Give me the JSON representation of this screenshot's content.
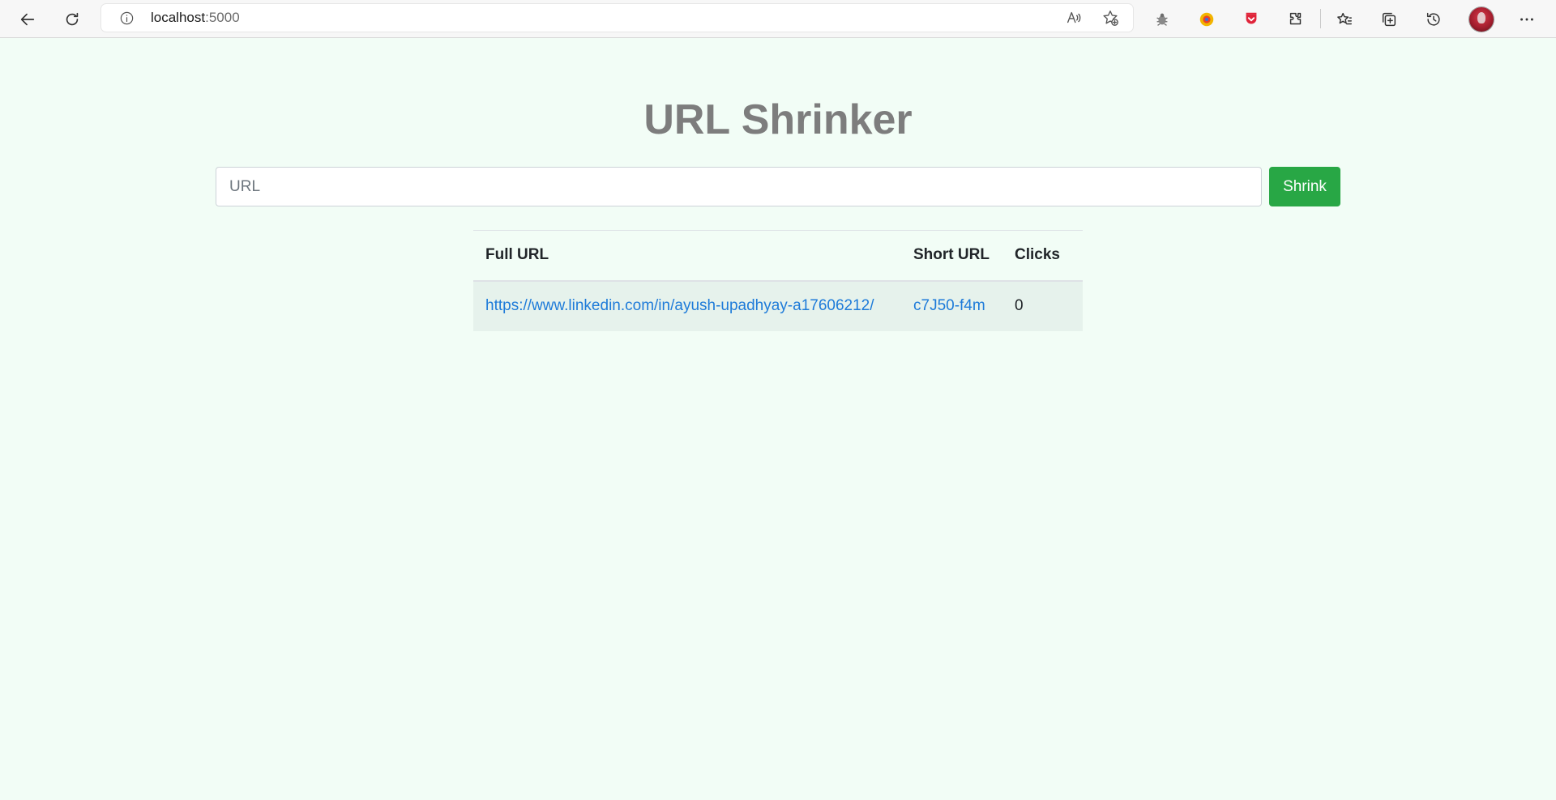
{
  "browser": {
    "address": {
      "host": "localhost",
      "port": ":5000"
    },
    "toolbar_icons": [
      "back-arrow-icon",
      "refresh-icon",
      "site-info-icon",
      "read-aloud-icon",
      "add-favorite-icon",
      "bug-extension-icon",
      "color-extension-icon",
      "pocket-extension-icon",
      "extensions-icon",
      "favorites-icon",
      "collections-icon",
      "history-icon",
      "profile-avatar",
      "more-menu-icon"
    ]
  },
  "page": {
    "title": "URL Shrinker",
    "form": {
      "url_placeholder": "URL",
      "url_value": "",
      "submit_label": "Shrink"
    },
    "table": {
      "headers": [
        "Full URL",
        "Short URL",
        "Clicks"
      ],
      "rows": [
        {
          "full_url": "https://www.linkedin.com/in/ayush-upadhyay-a17606212/",
          "short_url": "c7J50-f4m",
          "clicks": "0"
        }
      ]
    }
  },
  "colors": {
    "background": "#f2fdf6",
    "title": "#7d7d7d",
    "button": "#28a745",
    "link": "#1e7bd9",
    "row_highlight": "#e6f2ec"
  }
}
